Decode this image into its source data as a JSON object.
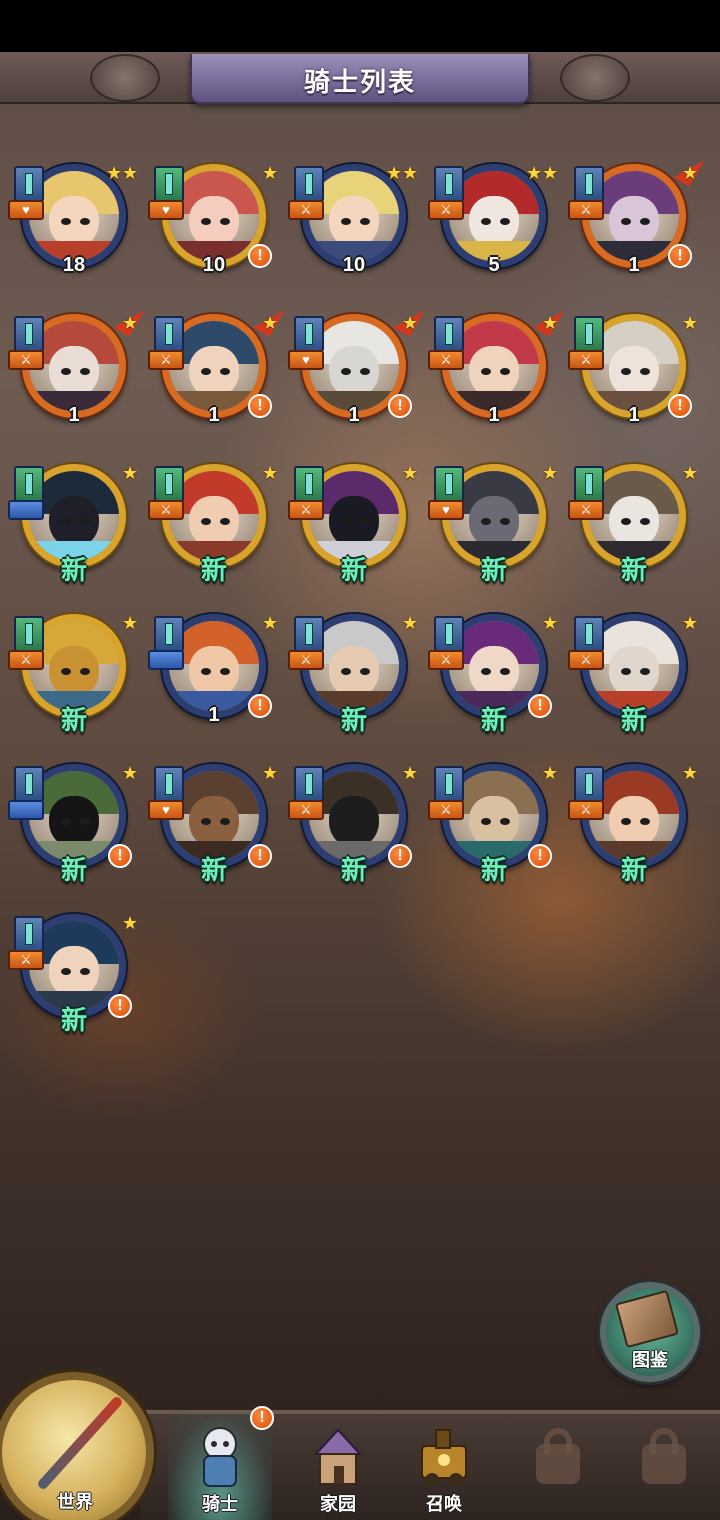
{
  "header": {
    "title": "骑士列表"
  },
  "knights": [
    {
      "count": "18",
      "frame": "blue",
      "stars": 2,
      "role": "♥",
      "new": false,
      "alert": false,
      "flag": false,
      "hair": "#e8c66e",
      "skin": "#f3d6bd",
      "body": "#b8402a"
    },
    {
      "count": "10",
      "frame": "gold",
      "stars": 1,
      "role": "♥",
      "new": false,
      "alert": true,
      "flag": false,
      "hair": "#c9574e",
      "skin": "#f4cdbf",
      "body": "#7a2e2e"
    },
    {
      "count": "10",
      "frame": "blue",
      "stars": 2,
      "role": "⚔",
      "new": false,
      "alert": false,
      "flag": false,
      "hair": "#e9d37a",
      "skin": "#f3d6bd",
      "body": "#3a4c7a"
    },
    {
      "count": "5",
      "frame": "blue",
      "stars": 2,
      "role": "⚔",
      "new": false,
      "alert": false,
      "flag": false,
      "hair": "#b22a2a",
      "skin": "#efe6df",
      "body": "#d9b548"
    },
    {
      "count": "1",
      "frame": "orange",
      "stars": 1,
      "role": "⚔",
      "new": false,
      "alert": true,
      "flag": true,
      "hair": "#6a3d7a",
      "skin": "#d8c6d8",
      "body": "#2d2d3a"
    },
    {
      "count": "1",
      "frame": "orange",
      "stars": 1,
      "role": "⚔",
      "new": false,
      "alert": false,
      "flag": true,
      "hair": "#b54a3a",
      "skin": "#e9ddd6",
      "body": "#3a2a3a"
    },
    {
      "count": "1",
      "frame": "orange",
      "stars": 1,
      "role": "⚔",
      "new": false,
      "alert": true,
      "flag": true,
      "hair": "#2d4a6a",
      "skin": "#f0d3bd",
      "body": "#7a5a3a"
    },
    {
      "count": "1",
      "frame": "orange",
      "stars": 1,
      "role": "♥",
      "new": false,
      "alert": true,
      "flag": true,
      "hair": "#e8e6e2",
      "skin": "#d8d6d2",
      "body": "#5a4a3a"
    },
    {
      "count": "1",
      "frame": "orange",
      "stars": 1,
      "role": "⚔",
      "new": false,
      "alert": false,
      "flag": true,
      "hair": "#c23a4a",
      "skin": "#f0d3bd",
      "body": "#3a2a2a"
    },
    {
      "count": "1",
      "frame": "gold",
      "stars": 1,
      "role": "⚔",
      "new": false,
      "alert": true,
      "flag": false,
      "hair": "#d6cfc4",
      "skin": "#eee3da",
      "body": "#6a5040"
    },
    {
      "count": "",
      "frame": "gold",
      "stars": 1,
      "role": "",
      "new": true,
      "alert": false,
      "flag": false,
      "hair": "#1d2a3a",
      "skin": "#1f1f2a",
      "body": "#7ad3e8"
    },
    {
      "count": "",
      "frame": "gold",
      "stars": 1,
      "role": "⚔",
      "new": true,
      "alert": false,
      "flag": false,
      "hair": "#c23a2a",
      "skin": "#f0ccb0",
      "body": "#8a3a2a"
    },
    {
      "count": "",
      "frame": "gold",
      "stars": 1,
      "role": "⚔",
      "new": true,
      "alert": false,
      "flag": false,
      "hair": "#5a2a6a",
      "skin": "#1a1a24",
      "body": "#cfcfd8"
    },
    {
      "count": "",
      "frame": "gold",
      "stars": 1,
      "role": "♥",
      "new": true,
      "alert": false,
      "flag": false,
      "hair": "#3a3a44",
      "skin": "#6a6a74",
      "body": "#2a2a30"
    },
    {
      "count": "",
      "frame": "gold",
      "stars": 1,
      "role": "⚔",
      "new": true,
      "alert": false,
      "flag": false,
      "hair": "#6a5a4a",
      "skin": "#eae6df",
      "body": "#2e2a30"
    },
    {
      "count": "",
      "frame": "gold",
      "stars": 1,
      "role": "⚔",
      "new": true,
      "alert": false,
      "flag": false,
      "hair": "#d6a83a",
      "skin": "#c89232",
      "body": "#3e6a8a"
    },
    {
      "count": "1",
      "frame": "blue",
      "stars": 1,
      "role": "",
      "new": false,
      "alert": true,
      "flag": false,
      "hair": "#d2622a",
      "skin": "#f0c8a8",
      "body": "#3a5aa0"
    },
    {
      "count": "",
      "frame": "blue",
      "stars": 1,
      "role": "⚔",
      "new": true,
      "alert": false,
      "flag": false,
      "hair": "#c9c9c9",
      "skin": "#e6cbb2",
      "body": "#5a3a2a"
    },
    {
      "count": "",
      "frame": "blue",
      "stars": 1,
      "role": "⚔",
      "new": true,
      "alert": true,
      "flag": false,
      "hair": "#6a2a7a",
      "skin": "#f0d8c8",
      "body": "#4a2a5a"
    },
    {
      "count": "",
      "frame": "blue",
      "stars": 1,
      "role": "⚔",
      "new": true,
      "alert": false,
      "flag": false,
      "hair": "#e9e3dc",
      "skin": "#e0d6cc",
      "body": "#b8402a"
    },
    {
      "count": "",
      "frame": "blue",
      "stars": 1,
      "role": "",
      "new": true,
      "alert": true,
      "flag": false,
      "hair": "#4a6a3a",
      "skin": "#151515",
      "body": "#7a8a6a"
    },
    {
      "count": "",
      "frame": "blue",
      "stars": 1,
      "role": "♥",
      "new": true,
      "alert": true,
      "flag": false,
      "hair": "#5a4030",
      "skin": "#8a6040",
      "body": "#3a2a20"
    },
    {
      "count": "",
      "frame": "blue",
      "stars": 1,
      "role": "⚔",
      "new": true,
      "alert": true,
      "flag": false,
      "hair": "#3a3026",
      "skin": "#1d1d1d",
      "body": "#6a6a6a"
    },
    {
      "count": "",
      "frame": "blue",
      "stars": 1,
      "role": "⚔",
      "new": true,
      "alert": true,
      "flag": false,
      "hair": "#8a7050",
      "skin": "#d8c0a0",
      "body": "#2a6a6a"
    },
    {
      "count": "",
      "frame": "blue",
      "stars": 1,
      "role": "⚔",
      "new": true,
      "alert": false,
      "flag": false,
      "hair": "#9a3a24",
      "skin": "#f0ccb0",
      "body": "#5a3a2a"
    },
    {
      "count": "",
      "frame": "blue",
      "stars": 1,
      "role": "⚔",
      "new": true,
      "alert": true,
      "flag": false,
      "hair": "#1e3a5a",
      "skin": "#f0d3bd",
      "body": "#2a3a4a"
    }
  ],
  "labels": {
    "new": "新",
    "alert": "!"
  },
  "codex": {
    "label": "图鉴"
  },
  "nav": {
    "world": "世界",
    "knights": "骑士",
    "home": "家园",
    "summon": "召唤",
    "alert": "!"
  }
}
